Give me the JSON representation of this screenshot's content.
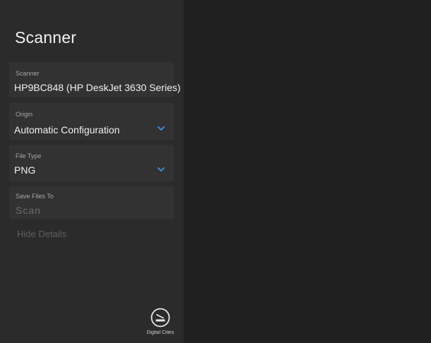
{
  "app": {
    "title": "Scanner"
  },
  "fields": {
    "scanner": {
      "label": "Scanner",
      "value": "HP9BC848 (HP DeskJet 3630 Series)"
    },
    "origin": {
      "label": "Origin",
      "value": "Automatic Configuration",
      "icon": "chevron-down-icon"
    },
    "file_type": {
      "label": "File Type",
      "value": "PNG",
      "icon": "chevron-down-icon"
    },
    "save_files_to": {
      "label": "Save Files To",
      "value": "Scan"
    }
  },
  "links": {
    "hide_details": "Hide Details"
  },
  "actions": {
    "scan": {
      "label": "Digital Cities",
      "icon": "scan-icon"
    }
  },
  "colors": {
    "sidebar_bg": "#2b2b2b",
    "main_bg": "#202020",
    "field_bg": "#323232",
    "accent": "#4a90e2"
  }
}
